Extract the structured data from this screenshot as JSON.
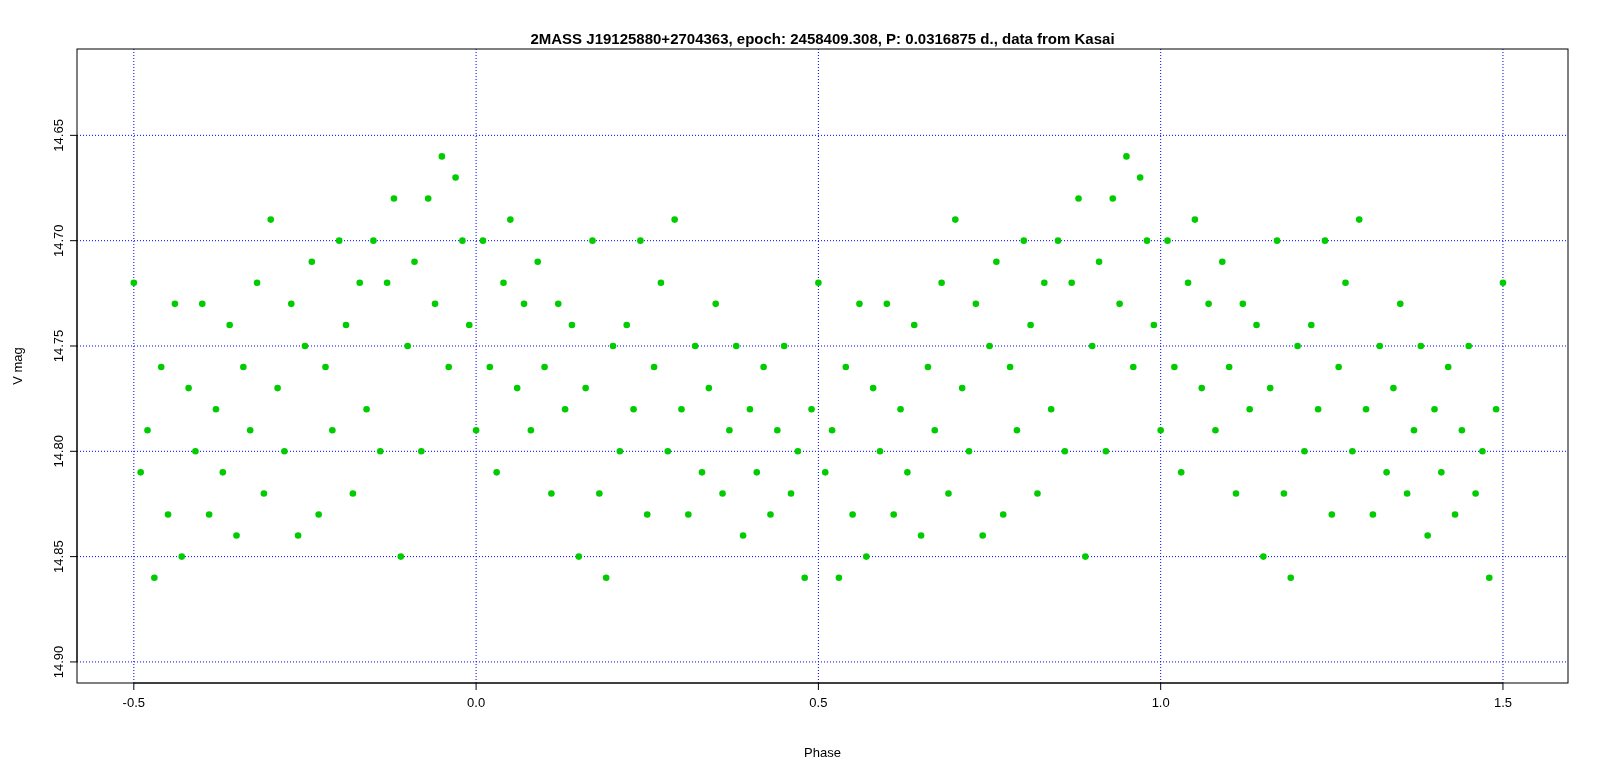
{
  "chart_data": {
    "type": "scatter",
    "title": "2MASS J19125880+2704363, epoch: 2458409.308, P: 0.0316875 d., data from Kasai",
    "xlabel": "Phase",
    "ylabel": "V mag",
    "xlim": [
      -0.583,
      1.595
    ],
    "ylim": [
      14.91,
      14.609
    ],
    "xticks": [
      {
        "value": -0.5,
        "label": "-0.5"
      },
      {
        "value": 0,
        "label": "0.0"
      },
      {
        "value": 0.5,
        "label": "0.5"
      },
      {
        "value": 1,
        "label": "1.0"
      },
      {
        "value": 1.5,
        "label": "1.5"
      }
    ],
    "yticks": [
      {
        "value": 14.65,
        "label": "14.65"
      },
      {
        "value": 14.7,
        "label": "14.70"
      },
      {
        "value": 14.75,
        "label": "14.75"
      },
      {
        "value": 14.8,
        "label": "14.80"
      },
      {
        "value": 14.85,
        "label": "14.85"
      },
      {
        "value": 14.9,
        "label": "14.90"
      }
    ],
    "x": [
      -0.5,
      -0.49,
      -0.48,
      -0.47,
      -0.46,
      -0.45,
      -0.44,
      -0.43,
      -0.42,
      -0.41,
      -0.4,
      -0.39,
      -0.38,
      -0.37,
      -0.36,
      -0.35,
      -0.34,
      -0.33,
      -0.32,
      -0.31,
      -0.3,
      -0.29,
      -0.28,
      -0.27,
      -0.26,
      -0.25,
      -0.24,
      -0.23,
      -0.22,
      -0.21,
      -0.2,
      -0.19,
      -0.18,
      -0.17,
      -0.16,
      -0.15,
      -0.14,
      -0.13,
      -0.12,
      -0.11,
      -0.1,
      -0.09,
      -0.08,
      -0.07,
      -0.06,
      -0.05,
      -0.04,
      -0.03,
      -0.02,
      -0.01,
      0,
      0.01,
      0.02,
      0.03,
      0.04,
      0.05,
      0.06,
      0.07,
      0.08,
      0.09,
      0.1,
      0.11,
      0.12,
      0.13,
      0.14,
      0.15,
      0.16,
      0.17,
      0.18,
      0.19,
      0.2,
      0.21,
      0.22,
      0.23,
      0.24,
      0.25,
      0.26,
      0.27,
      0.28,
      0.29,
      0.3,
      0.31,
      0.32,
      0.33,
      0.34,
      0.35,
      0.36,
      0.37,
      0.38,
      0.39,
      0.4,
      0.41,
      0.42,
      0.43,
      0.44,
      0.45,
      0.46,
      0.47,
      0.48,
      0.49,
      0.5,
      0.51,
      0.52,
      0.53,
      0.54,
      0.55,
      0.56,
      0.57,
      0.58,
      0.59,
      0.6,
      0.61,
      0.62,
      0.63,
      0.64,
      0.65,
      0.66,
      0.67,
      0.68,
      0.69,
      0.7,
      0.71,
      0.72,
      0.73,
      0.74,
      0.75,
      0.76,
      0.77,
      0.78,
      0.79,
      0.8,
      0.81,
      0.82,
      0.83,
      0.84,
      0.85,
      0.86,
      0.87,
      0.88,
      0.89,
      0.9,
      0.91,
      0.92,
      0.93,
      0.94,
      0.95,
      0.96,
      0.97,
      0.98,
      0.99,
      1,
      1.01,
      1.02,
      1.03,
      1.04,
      1.05,
      1.06,
      1.07,
      1.08,
      1.09,
      1.1,
      1.11,
      1.12,
      1.13,
      1.14,
      1.15,
      1.16,
      1.17,
      1.18,
      1.19,
      1.2,
      1.21,
      1.22,
      1.23,
      1.24,
      1.25,
      1.26,
      1.27,
      1.28,
      1.29,
      1.3,
      1.31,
      1.32,
      1.33,
      1.34,
      1.35,
      1.36,
      1.37,
      1.38,
      1.39,
      1.4,
      1.41,
      1.42,
      1.43,
      1.44,
      1.45,
      1.46,
      1.47,
      1.48,
      1.49,
      1.5
    ],
    "grid": true,
    "series": [
      {
        "color": "#00cc00",
        "values": [
          14.72,
          14.81,
          14.79,
          14.86,
          14.76,
          14.83,
          14.73,
          14.85,
          14.77,
          14.8,
          14.73,
          14.83,
          14.78,
          14.81,
          14.74,
          14.84,
          14.76,
          14.79,
          14.72,
          14.82,
          14.69,
          14.77,
          14.8,
          14.73,
          14.84,
          14.75,
          14.71,
          14.83,
          14.76,
          14.79,
          14.7,
          14.74,
          14.82,
          14.72,
          14.78,
          14.7,
          14.8,
          14.72,
          14.68,
          14.85,
          14.75,
          14.71,
          14.8,
          14.68,
          14.73,
          14.66,
          14.76,
          14.67,
          14.7,
          14.74,
          14.79,
          14.7,
          14.76,
          14.81,
          14.72,
          14.69,
          14.77,
          14.73,
          14.79,
          14.71,
          14.76,
          14.82,
          14.73,
          14.78,
          14.74,
          14.85,
          14.77,
          14.7,
          14.82,
          14.86,
          14.75,
          14.8,
          14.74,
          14.78,
          14.7,
          14.83,
          14.76,
          14.72,
          14.8,
          14.69,
          14.78,
          14.83,
          14.75,
          14.81,
          14.77,
          14.73,
          14.82,
          14.79,
          14.75,
          14.84,
          14.78,
          14.81,
          14.76,
          14.83,
          14.79,
          14.75,
          14.82,
          14.8,
          14.86,
          14.78,
          14.72,
          14.81,
          14.79,
          14.86,
          14.76,
          14.83,
          14.73,
          14.85,
          14.77,
          14.8,
          14.73,
          14.83,
          14.78,
          14.81,
          14.74,
          14.84,
          14.76,
          14.79,
          14.72,
          14.82,
          14.69,
          14.77,
          14.8,
          14.73,
          14.84,
          14.75,
          14.71,
          14.83,
          14.76,
          14.79,
          14.7,
          14.74,
          14.82,
          14.72,
          14.78,
          14.7,
          14.8,
          14.72,
          14.68,
          14.85,
          14.75,
          14.71,
          14.8,
          14.68,
          14.73,
          14.66,
          14.76,
          14.67,
          14.7,
          14.74,
          14.79,
          14.7,
          14.76,
          14.81,
          14.72,
          14.69,
          14.77,
          14.73,
          14.79,
          14.71,
          14.76,
          14.82,
          14.73,
          14.78,
          14.74,
          14.85,
          14.77,
          14.7,
          14.82,
          14.86,
          14.75,
          14.8,
          14.74,
          14.78,
          14.7,
          14.83,
          14.76,
          14.72,
          14.8,
          14.69,
          14.78,
          14.83,
          14.75,
          14.81,
          14.77,
          14.73,
          14.82,
          14.79,
          14.75,
          14.84,
          14.78,
          14.81,
          14.76,
          14.83,
          14.79,
          14.75,
          14.82,
          14.8,
          14.86,
          14.78,
          14.72
        ]
      }
    ]
  }
}
